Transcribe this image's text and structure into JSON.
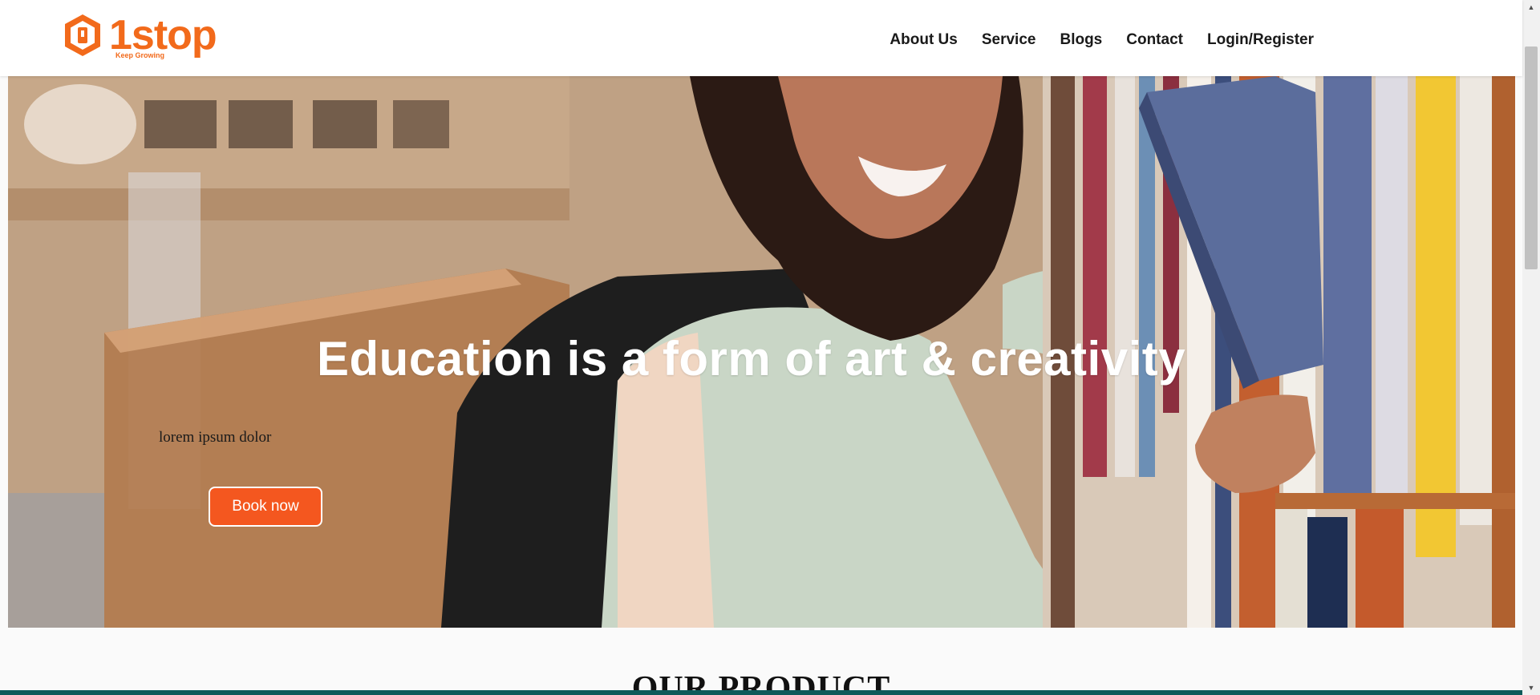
{
  "brand": {
    "name": "1stop",
    "tagline": "Keep Growing",
    "color": "#f26a1b"
  },
  "nav": {
    "items": [
      {
        "label": "About Us"
      },
      {
        "label": "Service"
      },
      {
        "label": "Blogs"
      },
      {
        "label": "Contact"
      },
      {
        "label": "Login/Register"
      }
    ]
  },
  "hero": {
    "title": "Education is a form of art & creativity",
    "subtitle": "lorem ipsum dolor",
    "cta_label": "Book now",
    "cta_color": "#f4571f"
  },
  "section": {
    "title": "OUR PRODUCT"
  },
  "colors": {
    "bottom_bar": "#0e5a5a"
  }
}
